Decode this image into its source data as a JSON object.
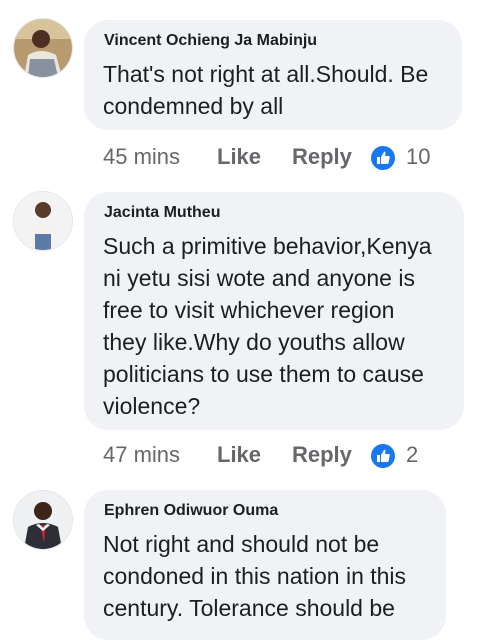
{
  "comments": [
    {
      "author": "Vincent Ochieng Ja Mabinju",
      "lines": [
        "That's not right at all.Should. Be",
        "condemned by all"
      ],
      "time": "45 mins",
      "like_label": "Like",
      "reply_label": "Reply",
      "reaction_count": "10"
    },
    {
      "author": "Jacinta Mutheu",
      "lines": [
        "Such a primitive behavior,Kenya",
        "ni yetu sisi wote and anyone is",
        "free to visit whichever region",
        "they like.Why do youths allow",
        "politicians to use them to cause",
        "violence?"
      ],
      "time": "47 mins",
      "like_label": "Like",
      "reply_label": "Reply",
      "reaction_count": "2"
    },
    {
      "author": "Ephren Odiwuor Ouma",
      "lines": [
        "Not right and should not be",
        "condoned in this nation in this",
        "century. Tolerance should be"
      ]
    }
  ],
  "icons": {
    "reaction": "like-thumbs-up-icon"
  },
  "colors": {
    "bubble": "#f0f2f5",
    "meta_text": "#65676b",
    "like_blue": "#1877f2"
  }
}
